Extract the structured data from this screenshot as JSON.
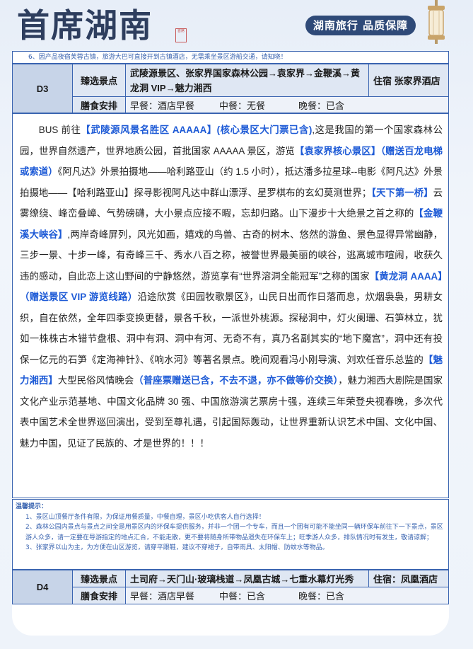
{
  "header": {
    "brand": "首席湖南",
    "seal": "首席",
    "slogan": "湖南旅行 品质保障"
  },
  "top_note": "6、因产品夜宿芙蓉古镇，旅游大巴可直接开到古镇酒店，无需乘坐景区游船交通，请知晓！",
  "day3": {
    "day": "D3",
    "spots_label": "臻选景点",
    "route": "武陵源景区、张家界国家森林公园→袁家界→金鞭溪→黄龙洞 VIP→魅力湘西",
    "stay": "住宿 张家界酒店",
    "meals_label": "膳食安排",
    "breakfast": "早餐：酒店早餐",
    "lunch": "中餐：无餐",
    "dinner": "晚餐：已含"
  },
  "body": {
    "s1": "BUS 前往",
    "h1": "【武陵源风景名胜区 AAAAA】(核心景区大门票已含)",
    "s2": ",这是我国的第一个国家森林公园，世界自然遗产，世界地质公园，首批国家 AAAAA 景区，游览",
    "h2": "【袁家界核心景区】（赠送百龙电梯或索道）",
    "s3": "《阿凡达》外景拍摄地——哈利路亚山（约 1.5 小时），抵达潘多拉星球--电影《阿凡达》外景拍摄地——【哈利路亚山】探寻影视阿凡达中群山漂浮、星罗棋布的玄幻莫测世界；",
    "h3": "【天下第一桥】",
    "s4": "云雾缭绕、峰峦叠嶂、气势磅礴，大小景点应接不暇，忘却归路。山下漫步十大绝景之首之称的",
    "h4": "【金鞭溪大峡谷】",
    "s5": ",两岸奇峰屏列，风光如画，嬉戏的鸟兽、古奇的树木、悠然的游鱼、景色显得异常幽静，三步一景、十步一峰，有奇峰三千、秀水八百之称，被誉世界最美丽的峡谷，逃离城市喧闹，收获久违的感动，自此恋上这山野间的宁静悠然，游览享有“世界溶洞全能冠军”之称的国家",
    "h5": "【黄龙洞 AAAA】（赠送景区 VIP 游览线路）",
    "s6": "沿途欣赏《田园牧歌景区》，山民日出而作日落而息，炊烟袅袅，男耕女织，自在依然，全年四季变换更替，景各千秋，一派世外桃源。探秘洞中，灯火阑珊、石笋林立，犹如一株株古木错节盘根、洞中有洞、洞中有河、无奇不有，真乃名副其实的“地下魔宫”，洞中还有投保一亿元的石笋《定海神针》、《响水河》等著名景点。晚间观看冯小刚导演、刘欢任音乐总监的",
    "h6": "【魅力湘西】",
    "s7": "大型民俗风情晚会",
    "h7": "（普座票赠送已含，不去不退，亦不做等价交换）",
    "s8": "，魅力湘西大剧院是国家文化产业示范基地、中国文化品牌 30 强、中国旅游演艺票房十强，连续三年荣登央视春晚，多次代表中国艺术全世界巡回演出，受到至尊礼遇，引起国际轰动，让世界重新认识艺术中国、文化中国、魅力中国，见证了民族的、才是世界的！！！"
  },
  "tips": {
    "title": "温馨提示：",
    "items": [
      "1、景区山顶餐厅条件有限，为保证用餐质量，中餐自理，景区小吃供客人自行选择！",
      "2、森林公园内景点与景点之间全是用景区内的环保车提供服务，并非一个团一个专车，而且一个团有可能不能坐同一辆环保车前往下一下景点，景区游人众多，请一定要在导游指定的地点汇合，不能走散，更不要将随身所带物品遗失在环保车上；旺季游人众多，排队情况时有发生，敬请谅解；",
      "3、张家界以山为主，为方便在山区游览，请穿平跟鞋，建议不穿裙子，自带雨具、太阳帽、防蚊水等物品。"
    ]
  },
  "day4": {
    "day": "D4",
    "spots_label": "臻选景点",
    "route": "土司府→天门山·玻璃栈道→凤凰古城→七重水幕灯光秀",
    "stay": "住宿：凤凰酒店",
    "meals_label": "膳食安排",
    "breakfast": "早餐：酒店早餐",
    "lunch": "中餐：已含",
    "dinner": "晚餐：已含"
  },
  "colors": {
    "accent": "#1d5ad6",
    "border": "#3a64b0",
    "label_bg": "#dfe7f3",
    "brand": "#2e3e5e"
  }
}
